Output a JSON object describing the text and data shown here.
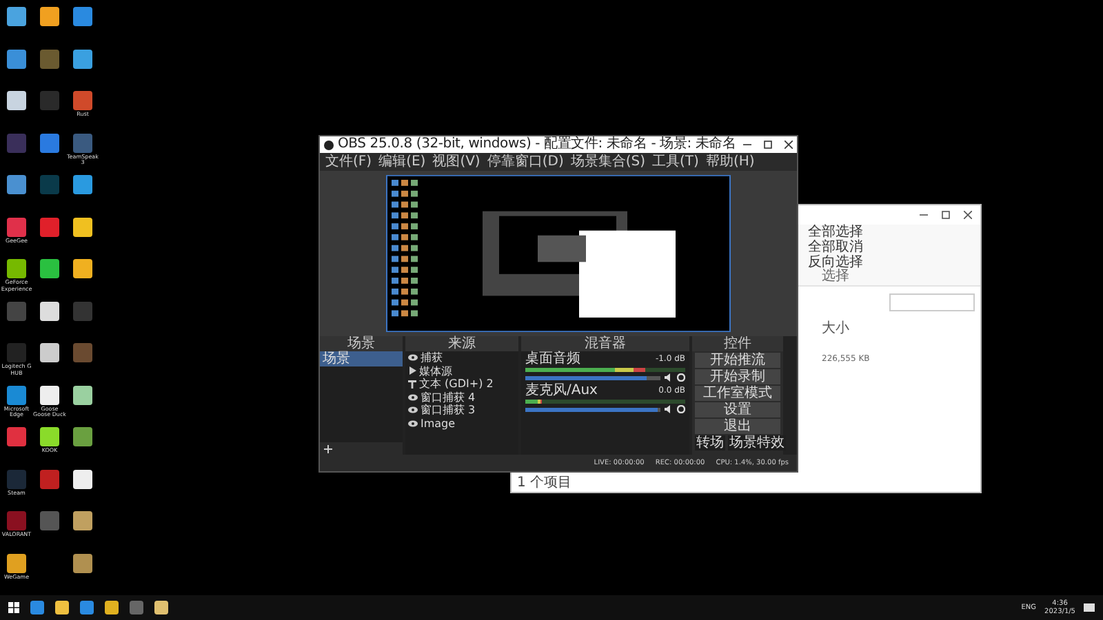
{
  "desktop": {
    "columns": [
      {
        "icons": [
          {
            "color": "#4aa3df"
          },
          {
            "color": "#3a8fd8"
          },
          {
            "color": "#c8d4e0"
          },
          {
            "color": "#3a2f5a"
          },
          {
            "color": "#4a90d0"
          },
          {
            "color": "#e0304a",
            "label": "GeeGee"
          },
          {
            "color": "#76b900",
            "label": "GeForce Experience"
          },
          {
            "color": "#444444"
          },
          {
            "color": "#222222",
            "label": "Logitech G HUB"
          },
          {
            "color": "#1a8ad4",
            "label": "Microsoft Edge"
          },
          {
            "color": "#e03040"
          },
          {
            "color": "#1b2838",
            "label": "Steam"
          },
          {
            "color": "#8a1020",
            "label": "VALORANT"
          },
          {
            "color": "#e0a020",
            "label": "WeGame"
          }
        ]
      },
      {
        "icons": [
          {
            "color": "#f0a020"
          },
          {
            "color": "#6a5a30"
          },
          {
            "color": "#2a2a2a"
          },
          {
            "color": "#2a7ae0"
          },
          {
            "color": "#0a3a4a"
          },
          {
            "color": "#e0202a"
          },
          {
            "color": "#2ac040"
          },
          {
            "color": "#dddddd"
          },
          {
            "color": "#cccccc"
          },
          {
            "color": "#eeeeee",
            "label": "Goose Goose Duck"
          },
          {
            "color": "#8adb2a",
            "label": "KOOK"
          },
          {
            "color": "#c02020"
          },
          {
            "color": "#555555"
          }
        ]
      },
      {
        "icons": [
          {
            "color": "#2a8ae0"
          },
          {
            "color": "#3aa0e0"
          },
          {
            "color": "#d04a2a",
            "label": "Rust"
          },
          {
            "color": "#3a5a80",
            "label": "TeamSpeak 3"
          },
          {
            "color": "#2a9ae0"
          },
          {
            "color": "#f0c020"
          },
          {
            "color": "#f0b020"
          },
          {
            "color": "#333333"
          },
          {
            "color": "#6a4a30"
          },
          {
            "color": "#9ad0a0"
          },
          {
            "color": "#6aa040"
          },
          {
            "color": "#eeeeee"
          },
          {
            "color": "#c0a060"
          },
          {
            "color": "#b09050"
          }
        ]
      }
    ]
  },
  "explorer": {
    "ribbon_items": [
      "全部选择",
      "全部取消",
      "反向选择"
    ],
    "ribbon_group": "选择",
    "column_header": "大小",
    "size": "226,555 KB",
    "status": "1 个项目"
  },
  "obs": {
    "title": "OBS 25.0.8 (32-bit, windows) - 配置文件: 未命名 - 场景: 未命名",
    "menu": [
      "文件(F)",
      "编辑(E)",
      "视图(V)",
      "停靠窗口(D)",
      "场景集合(S)",
      "工具(T)",
      "帮助(H)"
    ],
    "docks": {
      "scenes": "场景",
      "sources": "来源",
      "mixer": "混音器",
      "controls": "控件"
    },
    "scenes": [
      {
        "label": "场景",
        "selected": true
      }
    ],
    "sources": [
      {
        "kind": "capture",
        "label": "捕获"
      },
      {
        "kind": "media",
        "label": "媒体源"
      },
      {
        "kind": "text",
        "label": "文本 (GDI+) 2"
      },
      {
        "kind": "capture",
        "label": "窗口捕获 4"
      },
      {
        "kind": "capture",
        "label": "窗口捕获 3"
      },
      {
        "kind": "capture",
        "label": "Image"
      }
    ],
    "mixer": [
      {
        "name": "桌面音频",
        "reading": "-1.0 dB",
        "meter": {
          "level": 0.75
        },
        "volume": {
          "level": 0.9
        }
      },
      {
        "name": "麦克风/Aux",
        "reading": "0.0 dB",
        "meter": {
          "level": 0.1
        },
        "volume": {
          "level": 0.98
        }
      }
    ],
    "controls": [
      "开始推流",
      "开始录制",
      "工作室模式",
      "设置",
      "退出"
    ],
    "transition": [
      "转场",
      "场景特效"
    ],
    "status": [
      "LIVE: 00:00:00",
      "REC: 00:00:00",
      "CPU: 1.4%, 30.00 fps"
    ]
  },
  "taskbar": {
    "apps": [
      {
        "color": "#2a8ae0"
      },
      {
        "color": "#f0c040"
      },
      {
        "color": "#2a8ae0"
      },
      {
        "color": "#e0b020"
      },
      {
        "color": "#666666"
      },
      {
        "color": "#e0c070"
      }
    ],
    "language": "ENG",
    "time": "4:36",
    "date": "2023/1/5"
  }
}
